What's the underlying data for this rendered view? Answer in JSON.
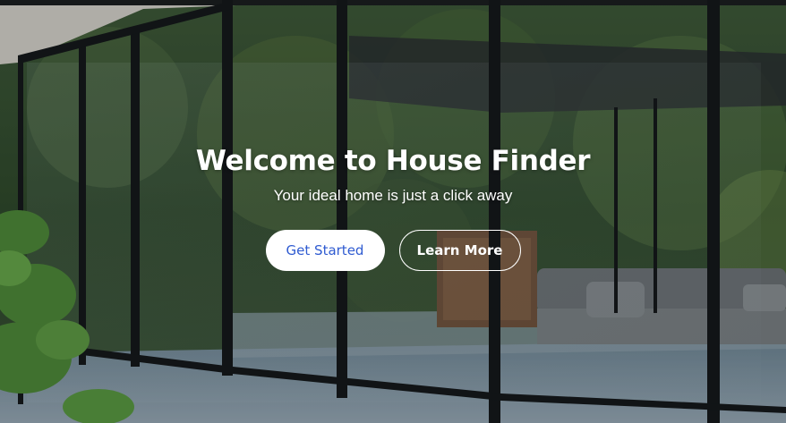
{
  "hero": {
    "title": "Welcome to House Finder",
    "subtitle": "Your ideal home is just a click away",
    "primary_button": "Get Started",
    "secondary_button": "Learn More",
    "background_image": "modern-glass-house-photo"
  },
  "colors": {
    "primary_button_text": "#2f5bd1",
    "primary_button_bg": "#ffffff",
    "text": "#ffffff"
  }
}
